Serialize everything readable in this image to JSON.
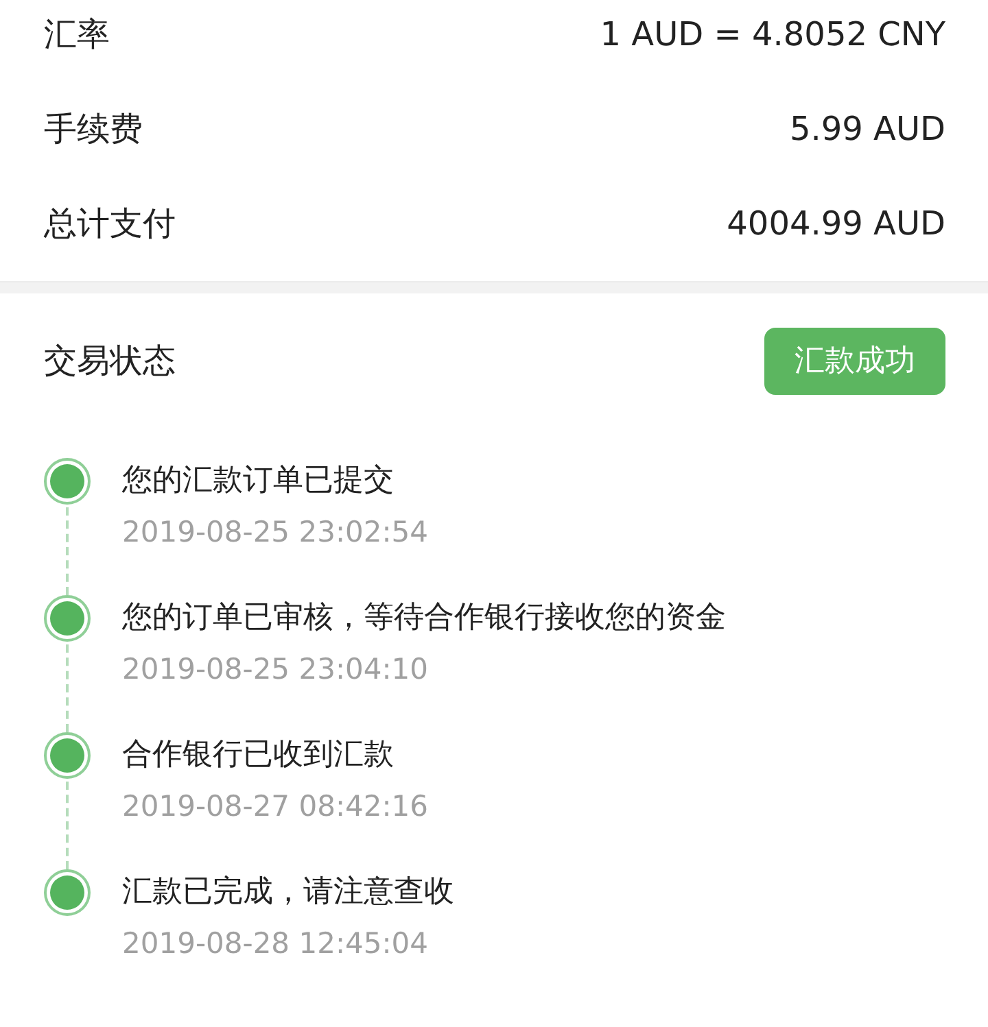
{
  "summary": [
    {
      "label": "汇率",
      "value": "1 AUD = 4.8052 CNY"
    },
    {
      "label": "手续费",
      "value": "5.99 AUD"
    },
    {
      "label": "总计支付",
      "value": "4004.99 AUD"
    }
  ],
  "status": {
    "label": "交易状态",
    "badge": "汇款成功"
  },
  "timeline": [
    {
      "title": "您的汇款订单已提交",
      "time": "2019-08-25 23:02:54"
    },
    {
      "title": "您的订单已审核，等待合作银行接收您的资金",
      "time": "2019-08-25 23:04:10"
    },
    {
      "title": "合作银行已收到汇款",
      "time": "2019-08-27 08:42:16"
    },
    {
      "title": "汇款已完成，请注意查收",
      "time": "2019-08-28 12:45:04"
    }
  ]
}
